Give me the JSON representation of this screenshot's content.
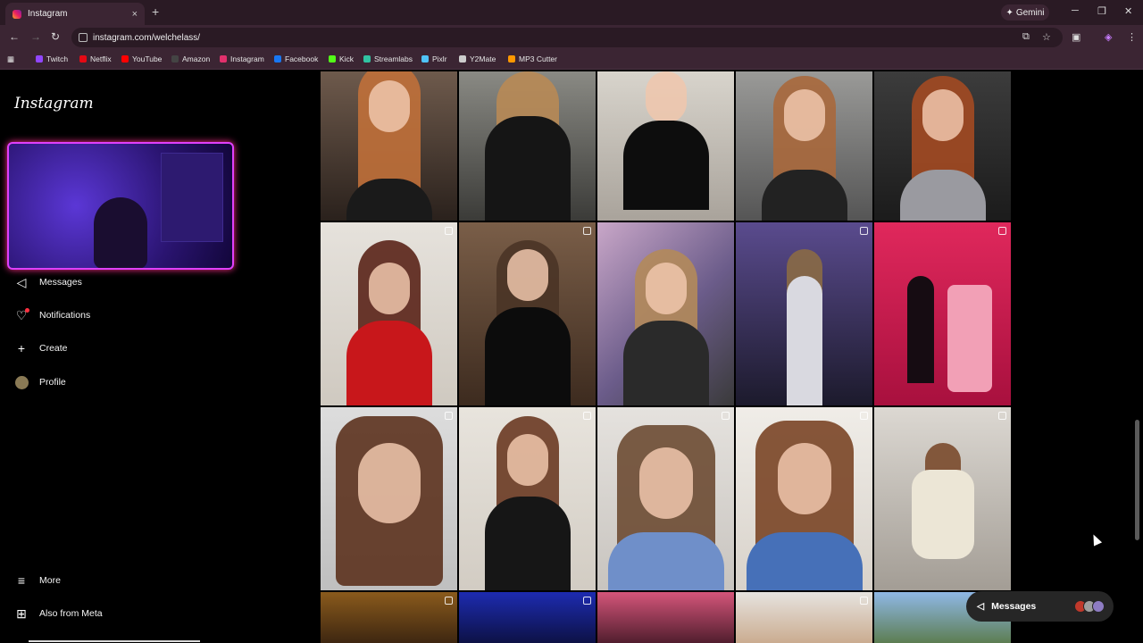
{
  "browser": {
    "tab_title": "Instagram",
    "tab_close": "×",
    "new_tab": "+",
    "gemini_label": "Gemini",
    "url": "instagram.com/welchelass/",
    "bookmarks": [
      {
        "label": "Twitch",
        "color": "#9146ff"
      },
      {
        "label": "Netflix",
        "color": "#e50914"
      },
      {
        "label": "YouTube",
        "color": "#ff0000"
      },
      {
        "label": "Amazon",
        "color": "#444444"
      },
      {
        "label": "Instagram",
        "color": "#e1306c"
      },
      {
        "label": "Facebook",
        "color": "#1877f2"
      },
      {
        "label": "Kick",
        "color": "#53fc18"
      },
      {
        "label": "Streamlabs",
        "color": "#31c3a2"
      },
      {
        "label": "Pixlr",
        "color": "#4fc3f7"
      },
      {
        "label": "Y2Mate",
        "color": "#cccccc"
      },
      {
        "label": "MP3 Cutter",
        "color": "#ff9800"
      }
    ]
  },
  "sidebar": {
    "logo": "Instagram",
    "items": [
      {
        "label": "Messages",
        "icon": "send-icon"
      },
      {
        "label": "Notifications",
        "icon": "heart-icon"
      },
      {
        "label": "Create",
        "icon": "plus-icon"
      },
      {
        "label": "Profile",
        "icon": "avatar"
      }
    ],
    "more_label": "More",
    "meta_label": "Also from Meta"
  },
  "messages_pill": {
    "label": "Messages"
  },
  "colors": {
    "accent": "#e040fb",
    "notification": "#ff3040"
  }
}
